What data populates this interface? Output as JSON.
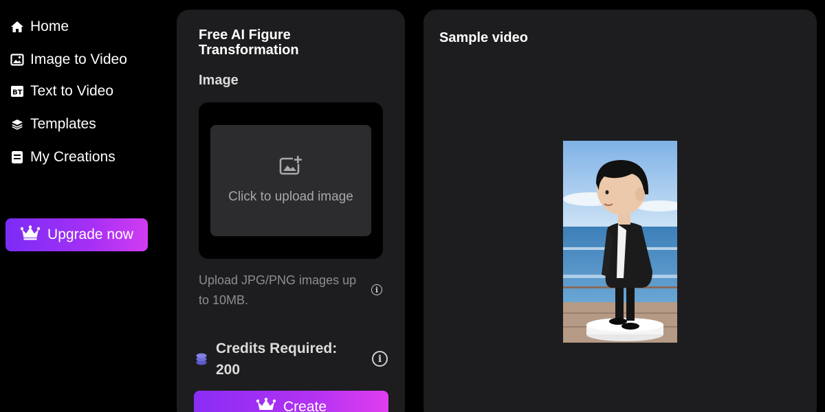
{
  "sidebar": {
    "items": [
      {
        "label": "Home",
        "icon": "home-icon"
      },
      {
        "label": "Image to Video",
        "icon": "image-icon"
      },
      {
        "label": "Text to Video",
        "icon": "text-video-icon"
      },
      {
        "label": "Templates",
        "icon": "layers-icon"
      },
      {
        "label": "My Creations",
        "icon": "folder-icon"
      }
    ],
    "upgrade_label": "Upgrade now"
  },
  "panel": {
    "title": "Free AI Figure Transformation",
    "image_label": "Image",
    "upload_text": "Click to upload image",
    "hint": "Upload JPG/PNG images up to 10MB.",
    "credits_label": "Credits Required: 200",
    "create_label": "Create"
  },
  "preview": {
    "title": "Sample video"
  },
  "colors": {
    "background": "#000000",
    "panel": "#1d1d1f",
    "accent_start": "#7b2cf5",
    "accent_end": "#d13cf2"
  }
}
